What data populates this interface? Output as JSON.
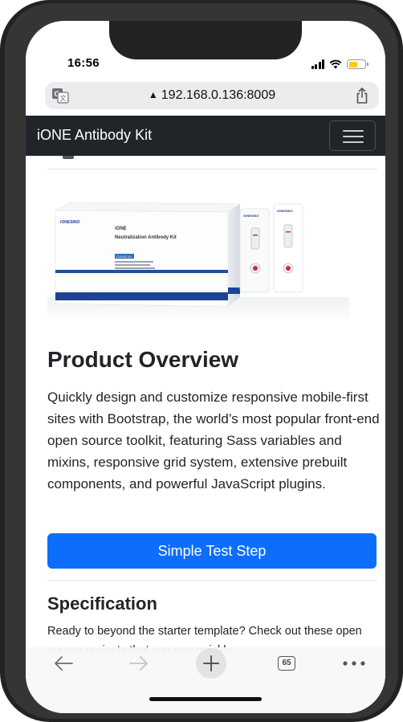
{
  "status_bar": {
    "time": "16:56",
    "battery_level": 0.55,
    "colors": {
      "battery_fill": "#ffcc00"
    }
  },
  "browser": {
    "url": "192.168.0.136:8009",
    "icons": {
      "translate": "translate-icon",
      "lock": "lock-icon",
      "share": "share-icon"
    }
  },
  "navbar": {
    "brand": "iONE Antibody Kit",
    "toggler_icon": "hamburger-icon",
    "colors": {
      "background": "#212529"
    }
  },
  "product": {
    "box_brand": "iONESINO",
    "box_title_line1": "iONE",
    "box_title_line2": "Neutralization Antibody Kit",
    "box_tag": "COVID-19",
    "cassette_brand": "iONESINO"
  },
  "overview": {
    "title": "Product Overview",
    "text": "Quickly design and customize responsive mobile-first sites with Bootstrap, the world’s most popular front-end open source toolkit, featuring Sass variables and mixins, responsive grid system, extensive prebuilt components, and powerful JavaScript plugins.",
    "button_label": "Simple Test Step",
    "colors": {
      "button": "#0d6efd"
    }
  },
  "specification": {
    "title": "Specification",
    "text": "Ready to beyond the starter template? Check out these open source projects that you can quickly"
  },
  "toolbar": {
    "tab_count": "65",
    "icons": [
      "back-arrow-icon",
      "forward-arrow-icon",
      "plus-icon",
      "tabs-icon",
      "more-icon"
    ]
  }
}
